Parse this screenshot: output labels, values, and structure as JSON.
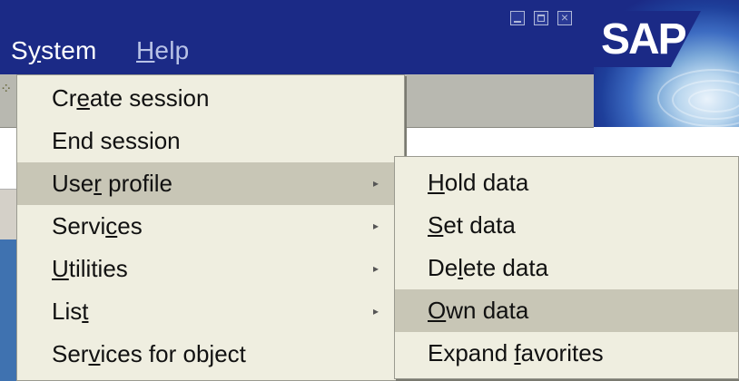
{
  "menubar": {
    "system": {
      "pre": "S",
      "u": "y",
      "post": "stem"
    },
    "help": {
      "pre": "",
      "u": "H",
      "post": "elp"
    }
  },
  "window_controls": [
    "minimize-icon",
    "maximize-icon",
    "close-icon"
  ],
  "logo": {
    "text": "SAP"
  },
  "main_menu": {
    "items": [
      {
        "pre": "Cr",
        "u": "e",
        "post": "ate session",
        "has_submenu": false,
        "highlighted": false
      },
      {
        "pre": "End session",
        "u": "",
        "post": "",
        "has_submenu": false,
        "highlighted": false
      },
      {
        "pre": "Use",
        "u": "r",
        "post": " profile",
        "has_submenu": true,
        "highlighted": true
      },
      {
        "pre": "Servi",
        "u": "c",
        "post": "es",
        "has_submenu": true,
        "highlighted": false
      },
      {
        "pre": "",
        "u": "U",
        "post": "tilities",
        "has_submenu": true,
        "highlighted": false
      },
      {
        "pre": "Lis",
        "u": "t",
        "post": "",
        "has_submenu": true,
        "highlighted": false
      },
      {
        "pre": "Ser",
        "u": "v",
        "post": "ices for object",
        "has_submenu": false,
        "highlighted": false
      }
    ],
    "arrow_glyph": "▸"
  },
  "sub_menu": {
    "items": [
      {
        "pre": "",
        "u": "H",
        "post": "old data",
        "highlighted": false
      },
      {
        "pre": "",
        "u": "S",
        "post": "et data",
        "highlighted": false
      },
      {
        "pre": "De",
        "u": "l",
        "post": "ete data",
        "highlighted": false
      },
      {
        "pre": "",
        "u": "O",
        "post": "wn data",
        "highlighted": true
      },
      {
        "pre": "Expand ",
        "u": "f",
        "post": "avorites",
        "highlighted": false
      }
    ]
  }
}
